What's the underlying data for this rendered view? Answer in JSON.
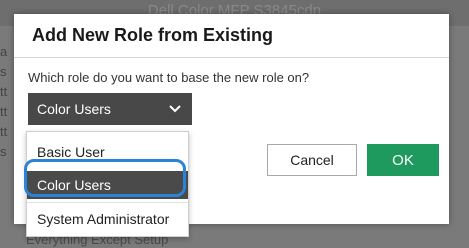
{
  "background": {
    "header_title": "Dell Color MFP S3845cdn",
    "left_fragments": [
      "a",
      "s",
      "tt",
      "tt",
      "tt",
      "s"
    ],
    "row_fragment": "A",
    "row_text": "Everything Except Setup"
  },
  "dialog": {
    "title": "Add New Role from Existing",
    "question": "Which role do you want to base the new role on?",
    "select": {
      "value": "Color Users",
      "icon": "chevron-down-icon"
    },
    "cancel_label": "Cancel",
    "ok_label": "OK",
    "colors": {
      "ok_button": "#1f9a5e",
      "select_bg": "#484848",
      "focus_ring": "#2a83d6"
    }
  },
  "dropdown": {
    "options": [
      {
        "label": "Basic User",
        "selected": false
      },
      {
        "label": "Color Users",
        "selected": true
      },
      {
        "label": "System Administrator",
        "selected": false
      }
    ]
  }
}
